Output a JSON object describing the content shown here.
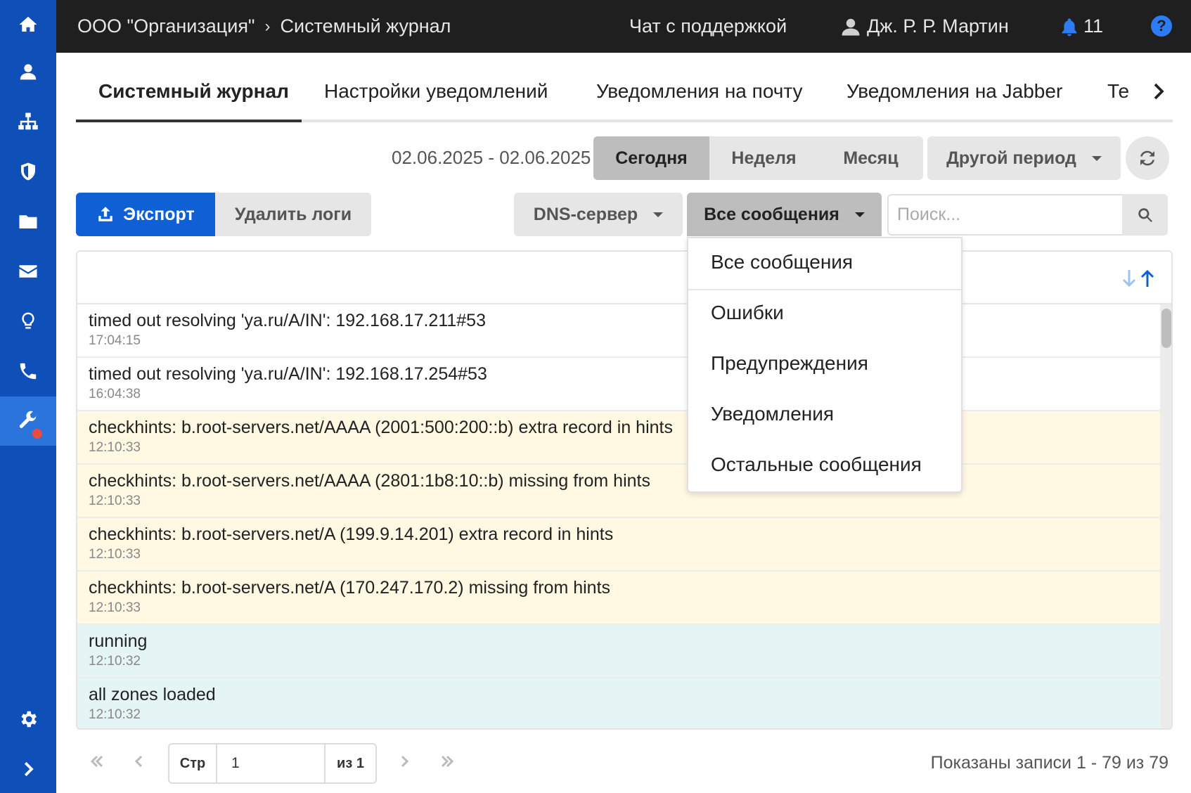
{
  "topbar": {
    "org": "ООО \"Организация\"",
    "breadcrumb_sep": "›",
    "page": "Системный журнал",
    "support": "Чат с поддержкой",
    "user": "Дж. Р. Р. Мартин",
    "notifications": "11",
    "help": "?"
  },
  "sidebar": {
    "items": [
      "home-icon",
      "user-icon",
      "sitemap-icon",
      "shield-icon",
      "folder-icon",
      "envelope-icon",
      "lightbulb-icon",
      "phone-icon",
      "wrench-icon",
      "gear-icon",
      "chevron-right-icon"
    ],
    "active": "wrench-icon",
    "accent": "#0f4fb8"
  },
  "tabs": [
    {
      "label": "Системный журнал"
    },
    {
      "label": "Настройки уведомлений"
    },
    {
      "label": "Уведомления на почту"
    },
    {
      "label": "Уведомления на Jabber"
    },
    {
      "label": "Те"
    }
  ],
  "period": {
    "range": "02.06.2025 - 02.06.2025",
    "today": "Сегодня",
    "week": "Неделя",
    "month": "Месяц",
    "other": "Другой период"
  },
  "actions": {
    "export": "Экспорт",
    "delete": "Удалить логи",
    "service": "DNS-сервер",
    "filter": "Все сообщения",
    "search_placeholder": "Поиск..."
  },
  "filter_menu": [
    "Все сообщения",
    "Ошибки",
    "Предупреждения",
    "Уведомления",
    "Остальные сообщения"
  ],
  "logs": [
    {
      "msg": "timed out resolving 'ya.ru/A/IN': 192.168.17.211#53",
      "time": "17:04:15",
      "level": "normal"
    },
    {
      "msg": "timed out resolving 'ya.ru/A/IN': 192.168.17.254#53",
      "time": "16:04:38",
      "level": "normal"
    },
    {
      "msg": "checkhints: b.root-servers.net/AAAA (2001:500:200::b) extra record in hints",
      "time": "12:10:33",
      "level": "warn"
    },
    {
      "msg": "checkhints: b.root-servers.net/AAAA (2801:1b8:10::b) missing from hints",
      "time": "12:10:33",
      "level": "warn"
    },
    {
      "msg": "checkhints: b.root-servers.net/A (199.9.14.201) extra record in hints",
      "time": "12:10:33",
      "level": "warn"
    },
    {
      "msg": "checkhints: b.root-servers.net/A (170.247.170.2) missing from hints",
      "time": "12:10:33",
      "level": "warn"
    },
    {
      "msg": "running",
      "time": "12:10:32",
      "level": "info"
    },
    {
      "msg": "all zones loaded",
      "time": "12:10:32",
      "level": "info"
    }
  ],
  "pagination": {
    "page_label": "Стр",
    "page_value": "1",
    "of_label": "из 1",
    "records": "Показаны записи 1 - 79 из 79"
  }
}
